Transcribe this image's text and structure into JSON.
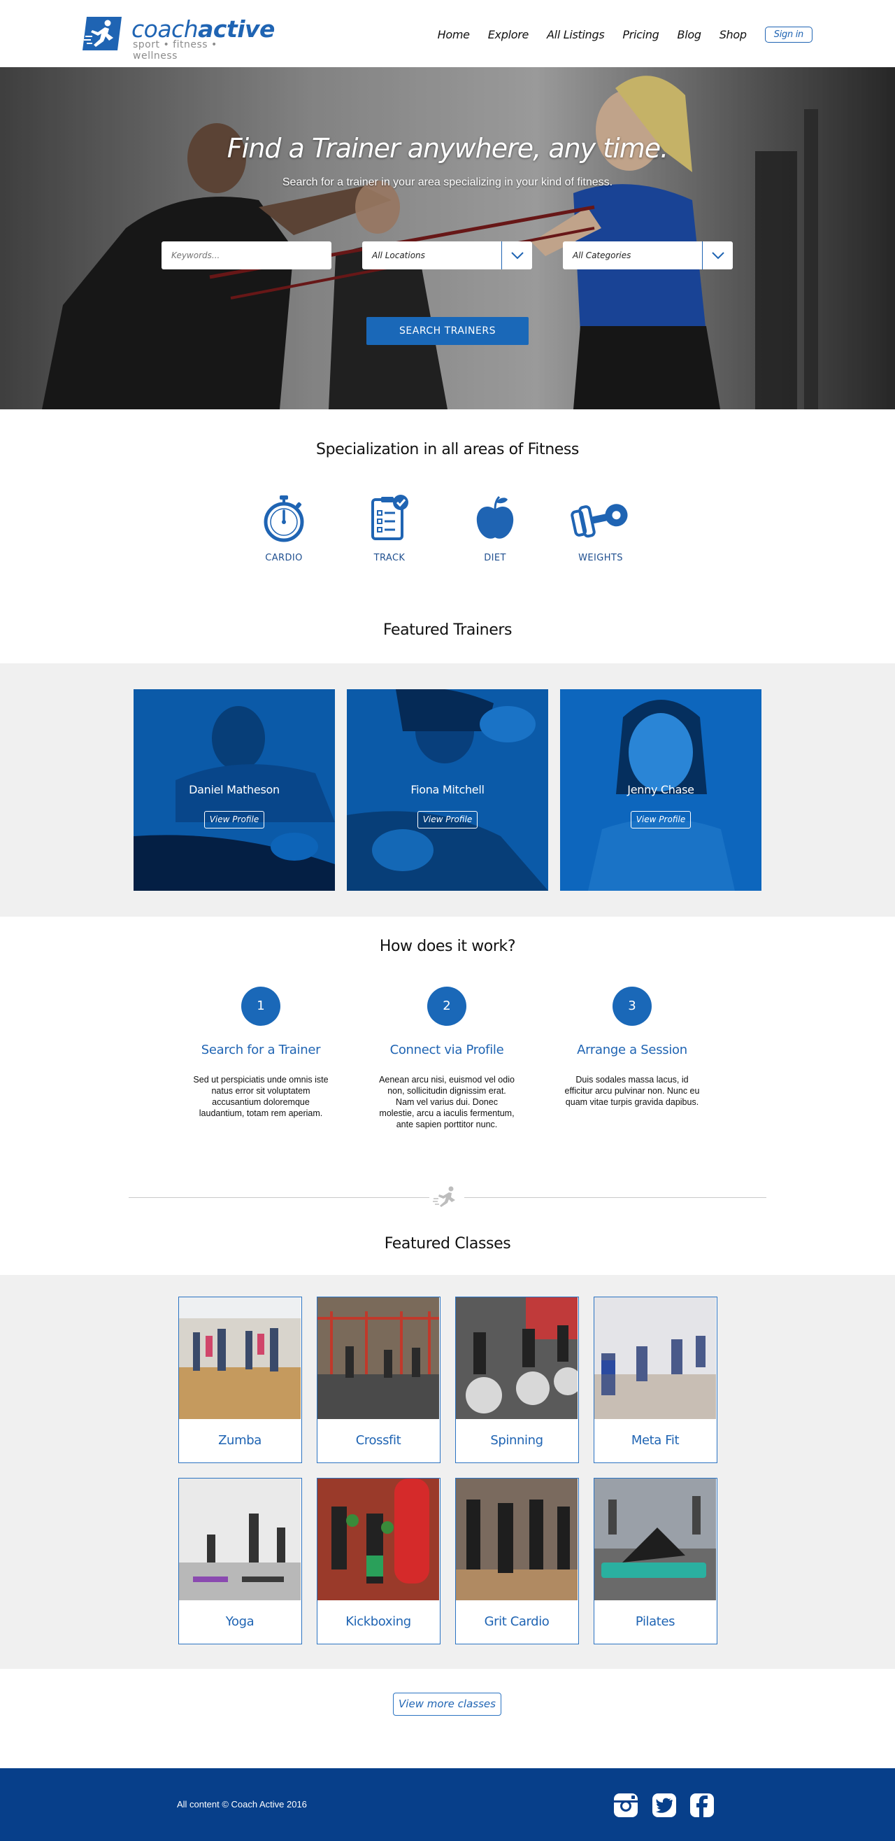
{
  "brand": {
    "name_light": "coach",
    "name_bold": "active",
    "tagline": "sport • fitness • wellness",
    "accent_color": "#1f64b3",
    "footer_color": "#073f8a"
  },
  "nav": {
    "items": [
      "Home",
      "Explore",
      "All Listings",
      "Pricing",
      "Blog",
      "Shop"
    ],
    "signin_label": "Sign in"
  },
  "hero": {
    "title": "Find a Trainer anywhere, any time.",
    "subtitle": "Search for a trainer in your area specializing in your kind of fitness.",
    "keywords_placeholder": "Keywords...",
    "location_value": "All Locations",
    "category_value": "All Categories",
    "search_button": "SEARCH TRAINERS"
  },
  "specialization": {
    "title": "Specialization in all areas of Fitness",
    "items": [
      {
        "label": "CARDIO",
        "icon": "stopwatch-icon"
      },
      {
        "label": "TRACK",
        "icon": "checklist-icon"
      },
      {
        "label": "DIET",
        "icon": "apple-icon"
      },
      {
        "label": "WEIGHTS",
        "icon": "dumbbell-icon"
      }
    ]
  },
  "trainers": {
    "title": "Featured Trainers",
    "items": [
      {
        "name": "Daniel Matheson",
        "button": "View Profile"
      },
      {
        "name": "Fiona Mitchell",
        "button": "View Profile"
      },
      {
        "name": "Jenny Chase",
        "button": "View Profile"
      }
    ]
  },
  "how": {
    "title": "How does it work?",
    "steps": [
      {
        "num": "1",
        "title": "Search for a Trainer",
        "text": "Sed ut perspiciatis unde omnis iste natus error sit voluptatem accusantium doloremque laudantium, totam rem aperiam."
      },
      {
        "num": "2",
        "title": "Connect via Profile",
        "text": "Aenean arcu nisi, euismod vel odio non, sollicitudin dignissim erat. Nam vel varius dui. Donec molestie, arcu a iaculis fermentum, ante sapien porttitor nunc."
      },
      {
        "num": "3",
        "title": "Arrange a Session",
        "text": "Duis sodales massa lacus, id efficitur arcu pulvinar non. Nunc eu quam vitae turpis gravida dapibus."
      }
    ]
  },
  "classes": {
    "title": "Featured Classes",
    "items": [
      "Zumba",
      "Crossfit",
      "Spinning",
      "Meta Fit",
      "Yoga",
      "Kickboxing",
      "Grit Cardio",
      "Pilates"
    ],
    "more_button": "View more classes"
  },
  "footer": {
    "copyright": "All content © Coach Active 2016",
    "social": [
      "instagram-icon",
      "twitter-icon",
      "facebook-icon"
    ]
  }
}
